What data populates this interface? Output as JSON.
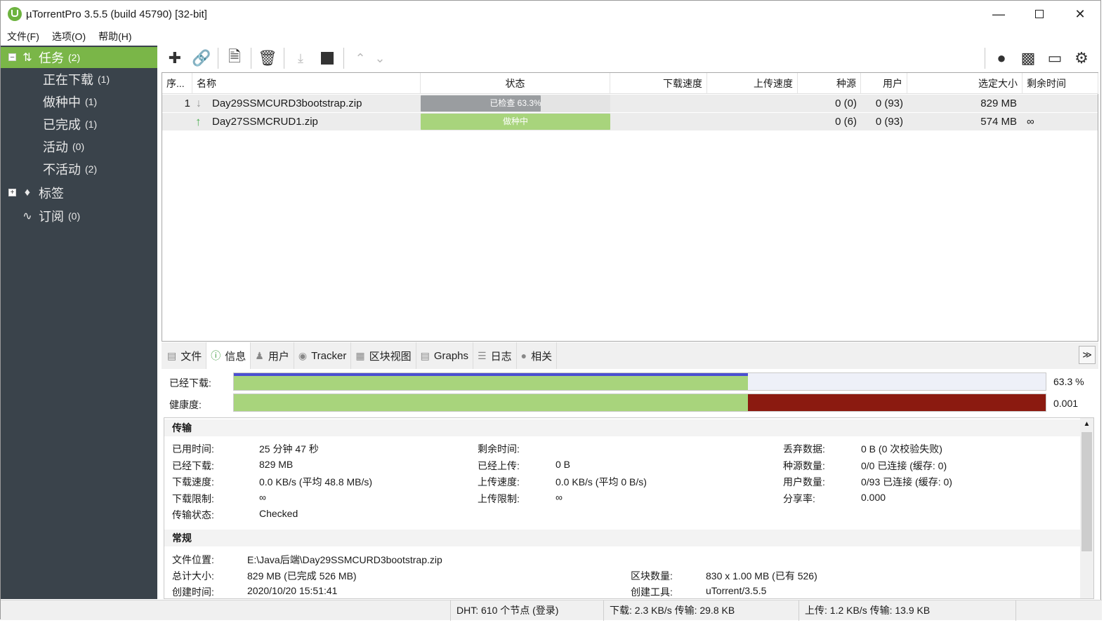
{
  "window": {
    "title": "µTorrentPro 3.5.5  (build 45790) [32-bit]"
  },
  "menu": [
    "文件(F)",
    "选项(O)",
    "帮助(H)"
  ],
  "sidebar": {
    "tasks": {
      "label": "任务",
      "count": "(2)"
    },
    "items": [
      {
        "label": "正在下载",
        "count": "(1)"
      },
      {
        "label": "做种中",
        "count": "(1)"
      },
      {
        "label": "已完成",
        "count": "(1)"
      },
      {
        "label": "活动",
        "count": "(0)"
      },
      {
        "label": "不活动",
        "count": "(2)"
      }
    ],
    "labels": {
      "label": "标签"
    },
    "feeds": {
      "label": "订阅",
      "count": "(0)"
    }
  },
  "table": {
    "headers": [
      "序...",
      "名称",
      "状态",
      "下载速度",
      "上传速度",
      "种源",
      "用户",
      "选定大小",
      "剩余时间"
    ],
    "rows": [
      {
        "index": "1",
        "name": "Day29SSMCURD3bootstrap.zip",
        "status": "已检查 63.3%",
        "progress": 0.633,
        "seeds": "0 (0)",
        "peers": "0 (93)",
        "size": "829 MB",
        "eta": "",
        "state": "checking"
      },
      {
        "index": "",
        "name": "Day27SSMCRUD1.zip",
        "status": "做种中",
        "progress": 1.0,
        "seeds": "0 (6)",
        "peers": "0 (93)",
        "size": "574 MB",
        "eta": "∞",
        "state": "seeding"
      }
    ]
  },
  "tabs": [
    "文件",
    "信息",
    "用户",
    "Tracker",
    "区块视图",
    "Graphs",
    "日志",
    "相关"
  ],
  "progress": {
    "downloaded_label": "已经下载:",
    "downloaded_value": "63.3 %",
    "downloaded_fraction": 0.633,
    "health_label": "健康度:",
    "health_value": "0.001"
  },
  "transfer": {
    "title": "传输",
    "col1": [
      {
        "k": "已用时间:",
        "v": "25 分钟 47 秒"
      },
      {
        "k": "已经下载:",
        "v": "829 MB"
      },
      {
        "k": "下载速度:",
        "v": "0.0 KB/s (平均 48.8 MB/s)"
      },
      {
        "k": "下载限制:",
        "v": "∞"
      },
      {
        "k": "传输状态:",
        "v": "Checked"
      }
    ],
    "col2": [
      {
        "k": "剩余时间:",
        "v": ""
      },
      {
        "k": "已经上传:",
        "v": "0 B"
      },
      {
        "k": "上传速度:",
        "v": "0.0 KB/s (平均 0 B/s)"
      },
      {
        "k": "上传限制:",
        "v": "∞"
      }
    ],
    "col3": [
      {
        "k": "丢弃数据:",
        "v": "0 B (0 次校验失败)"
      },
      {
        "k": "种源数量:",
        "v": "0/0 已连接 (缓存: 0)"
      },
      {
        "k": "用户数量:",
        "v": "0/93 已连接 (缓存: 0)"
      },
      {
        "k": "分享率:",
        "v": "0.000"
      }
    ]
  },
  "general": {
    "title": "常规",
    "col1": [
      {
        "k": "文件位置:",
        "v": "E:\\Java后端\\Day29SSMCURD3bootstrap.zip"
      },
      {
        "k": "总计大小:",
        "v": "829 MB (已完成 526 MB)"
      },
      {
        "k": "创建时间:",
        "v": "2020/10/20 15:51:41"
      }
    ],
    "col2": [
      {
        "k": "区块数量:",
        "v": "830 x 1.00 MB (已有 526)"
      },
      {
        "k": "创建工具:",
        "v": "uTorrent/3.5.5"
      }
    ]
  },
  "statusbar": {
    "dht": "DHT: 610 个节点  (登录)",
    "down": "下载: 2.3 KB/s 传输: 29.8 KB",
    "up": "上传: 1.2 KB/s 传输: 13.9 KB"
  },
  "colors": {
    "sidebar": "#3a434b",
    "selected": "#7ab648",
    "progress_green": "#a8d47c",
    "health_red": "#8b1a10",
    "download_blue": "#4b4fd1"
  }
}
